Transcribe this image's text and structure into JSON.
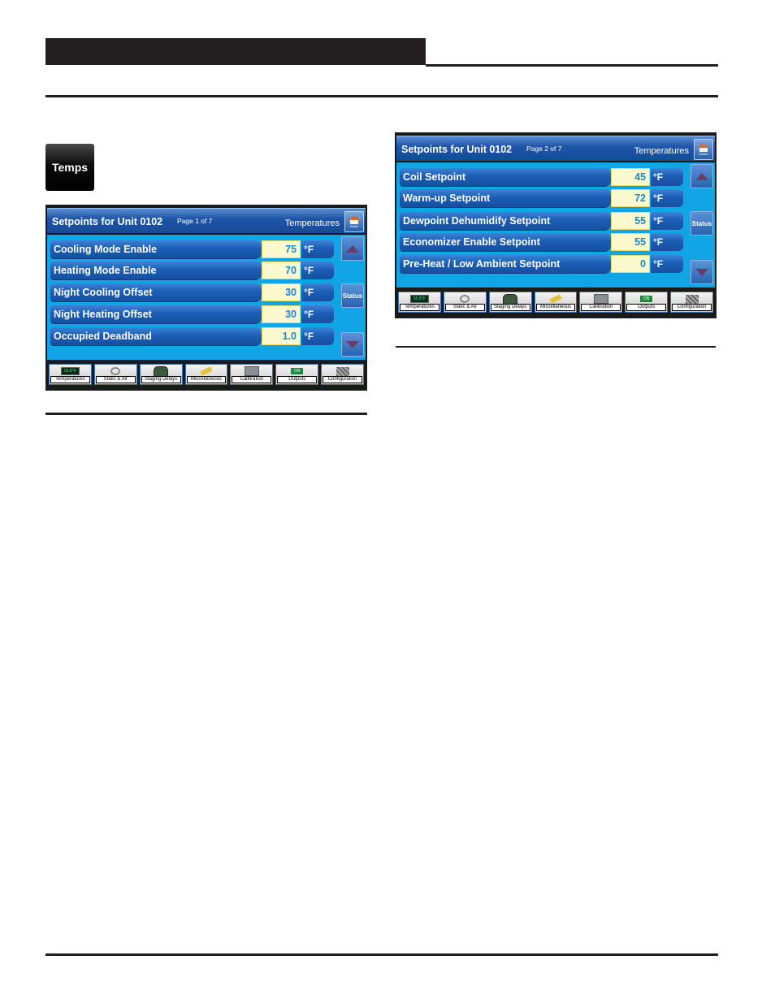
{
  "temps_button": {
    "label": "Temps"
  },
  "panels": [
    {
      "title": "Setpoints for Unit 0102",
      "page": "Page 1 of 7",
      "section": "Temperatures",
      "home_label": "Home",
      "rows": [
        {
          "label": "Cooling Mode Enable",
          "value": "75",
          "unit": "°F"
        },
        {
          "label": "Heating Mode Enable",
          "value": "70",
          "unit": "°F"
        },
        {
          "label": "Night Cooling Offset",
          "value": "30",
          "unit": "°F"
        },
        {
          "label": "Night Heating Offset",
          "value": "30",
          "unit": "°F"
        },
        {
          "label": "Occupied Deadband",
          "value": "1.0",
          "unit": "°F"
        }
      ],
      "status_label": "Status",
      "toolbar": [
        {
          "label": "Temperatures",
          "icon": "lcd-display-icon",
          "icon_text": "55.8°F"
        },
        {
          "label": "Static & Air",
          "icon": "damper-icon"
        },
        {
          "label": "Staging Delays",
          "icon": "controller-dial-icon"
        },
        {
          "label": "Miscellaneous",
          "icon": "pencil-icon"
        },
        {
          "label": "Calibration",
          "icon": "calibration-icon"
        },
        {
          "label": "Outputs",
          "icon": "on-indicator-icon",
          "icon_text": "ON"
        },
        {
          "label": "Configuration",
          "icon": "circuit-board-icon"
        }
      ]
    },
    {
      "title": "Setpoints for Unit 0102",
      "page": "Page 2 of 7",
      "section": "Temperatures",
      "home_label": "Home",
      "rows": [
        {
          "label": "Coil Setpoint",
          "value": "45",
          "unit": "°F"
        },
        {
          "label": "Warm-up Setpoint",
          "value": "72",
          "unit": "°F"
        },
        {
          "label": "Dewpoint Dehumidify Setpoint",
          "value": "55",
          "unit": "°F"
        },
        {
          "label": "Economizer Enable Setpoint",
          "value": "55",
          "unit": "°F"
        },
        {
          "label": "Pre-Heat / Low Ambient Setpoint",
          "value": "0",
          "unit": "°F"
        }
      ],
      "status_label": "Status",
      "toolbar": [
        {
          "label": "Temperatures",
          "icon": "lcd-display-icon",
          "icon_text": "55.8°F"
        },
        {
          "label": "Static & Air",
          "icon": "damper-icon"
        },
        {
          "label": "Staging Delays",
          "icon": "controller-dial-icon"
        },
        {
          "label": "Miscellaneous",
          "icon": "pencil-icon"
        },
        {
          "label": "Calibration",
          "icon": "calibration-icon"
        },
        {
          "label": "Outputs",
          "icon": "on-indicator-icon",
          "icon_text": "ON"
        },
        {
          "label": "Configuration",
          "icon": "circuit-board-icon"
        }
      ]
    }
  ]
}
